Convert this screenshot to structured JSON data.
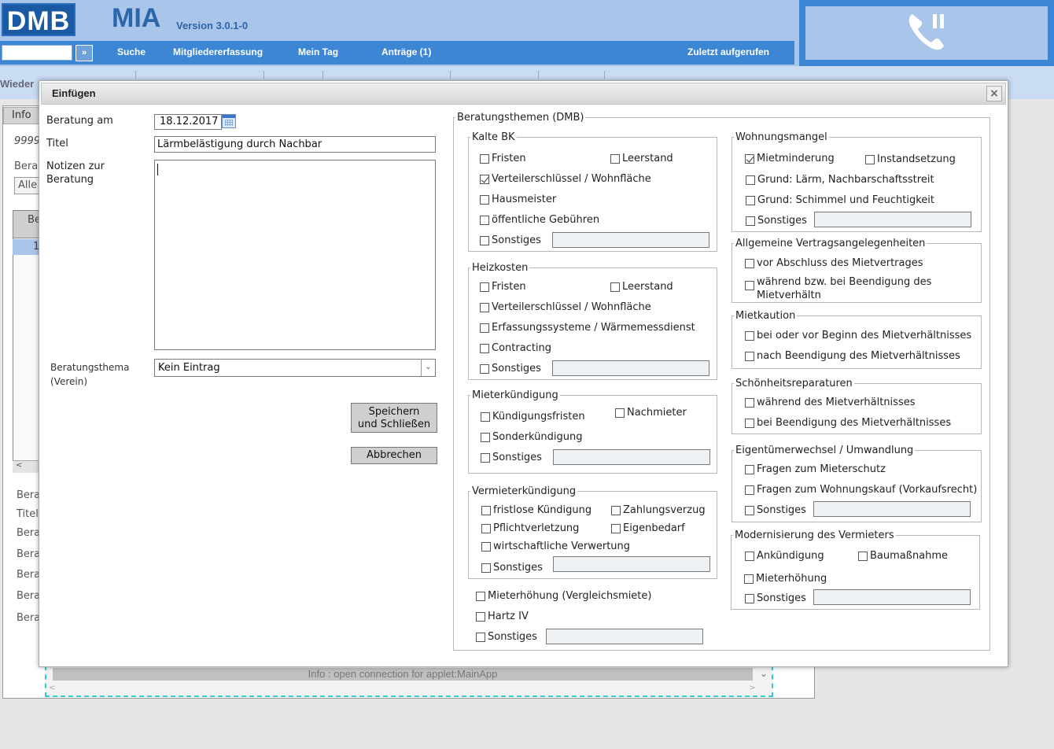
{
  "header": {
    "logo": "DMB",
    "app_name": "MIA",
    "version": "Version 3.0.1-0",
    "go_label": "»",
    "nav": [
      "Suche",
      "Mitgliedererfassung",
      "Mein Tag",
      "Anträge (1)",
      "Zuletzt aufgerufen"
    ]
  },
  "background": {
    "toolbar_label": "Wieder",
    "tab_info": "Info",
    "number": "9999",
    "bera": "Bera",
    "alle": "Alle",
    "table_head": "Be",
    "table_cell": "1",
    "labels": [
      "Bera",
      "Titel",
      "Bera",
      "Bera",
      "Bera",
      "Bera",
      "Bera"
    ],
    "status_text": "Info : open connection for applet:MainApp"
  },
  "modal": {
    "title": "Einfügen",
    "close": "×",
    "beratung_am_label": "Beratung am",
    "beratung_am_value": "18.12.2017",
    "titel_label": "Titel",
    "titel_value": "Lärmbelästigung durch Nachbar",
    "notizen_label_1": "Notizen zur",
    "notizen_label_2": "Beratung",
    "thema_label_1": "Beratungsthema",
    "thema_label_2": "(Verein)",
    "thema_value": "Kein Eintrag",
    "save_1": "Speichern",
    "save_2": "und Schließen",
    "cancel": "Abbrechen",
    "themen_legend": "Beratungsthemen (DMB)",
    "kalte_bk": {
      "legend": "Kalte BK",
      "items": [
        "Fristen",
        "Leerstand",
        "Verteilerschlüssel / Wohnfläche",
        "Hausmeister",
        "öffentliche Gebühren",
        "Sonstiges"
      ]
    },
    "heizkosten": {
      "legend": "Heizkosten",
      "items": [
        "Fristen",
        "Leerstand",
        "Verteilerschlüssel / Wohnfläche",
        "Erfassungssysteme / Wärmemessdienst",
        "Contracting",
        "Sonstiges"
      ]
    },
    "mieterkuendigung": {
      "legend": "Mieterkündigung",
      "items": [
        "Kündigungsfristen",
        "Nachmieter",
        "Sonderkündigung",
        "Sonstiges"
      ]
    },
    "vermieterkuendigung": {
      "legend": "Vermieterkündigung",
      "items": [
        "fristlose Kündigung",
        "Zahlungsverzug",
        "Pflichtverletzung",
        "Eigenbedarf",
        "wirtschaftliche Verwertung",
        "Sonstiges"
      ]
    },
    "loose": [
      "Mieterhöhung (Vergleichsmiete)",
      "Hartz IV",
      "Sonstiges"
    ],
    "wohnungsmangel": {
      "legend": "Wohnungsmangel",
      "items": [
        "Mietminderung",
        "Instandsetzung",
        "Grund: Lärm, Nachbarschaftsstreit",
        "Grund: Schimmel und Feuchtigkeit",
        "Sonstiges"
      ]
    },
    "allgemeine": {
      "legend": "Allgemeine Vertragsangelegenheiten",
      "items": [
        "vor Abschluss des Mietvertrages",
        "während bzw. bei Beendigung des",
        "Mietverhältn"
      ]
    },
    "mietkaution": {
      "legend": "Mietkaution",
      "items": [
        "bei oder vor Beginn des Mietverhältnisses",
        "nach Beendigung des Mietverhältnisses"
      ]
    },
    "schoenheit": {
      "legend": "Schönheitsreparaturen",
      "items": [
        "während des Mietverhältnisses",
        "bei Beendigung des Mietverhältnisses"
      ]
    },
    "eigentuemer": {
      "legend": "Eigentümerwechsel / Umwandlung",
      "items": [
        "Fragen zum Mieterschutz",
        "Fragen zum Wohnungskauf (Vorkaufsrecht)",
        "Sonstiges"
      ]
    },
    "modernisierung": {
      "legend": "Modernisierung des Vermieters",
      "items": [
        "Ankündigung",
        "Baumaßnahme",
        "Mieterhöhung",
        "Sonstiges"
      ]
    }
  },
  "checked": [
    "Verteilerschlüssel / Wohnfläche (Kalte BK)",
    "Mietminderung"
  ]
}
